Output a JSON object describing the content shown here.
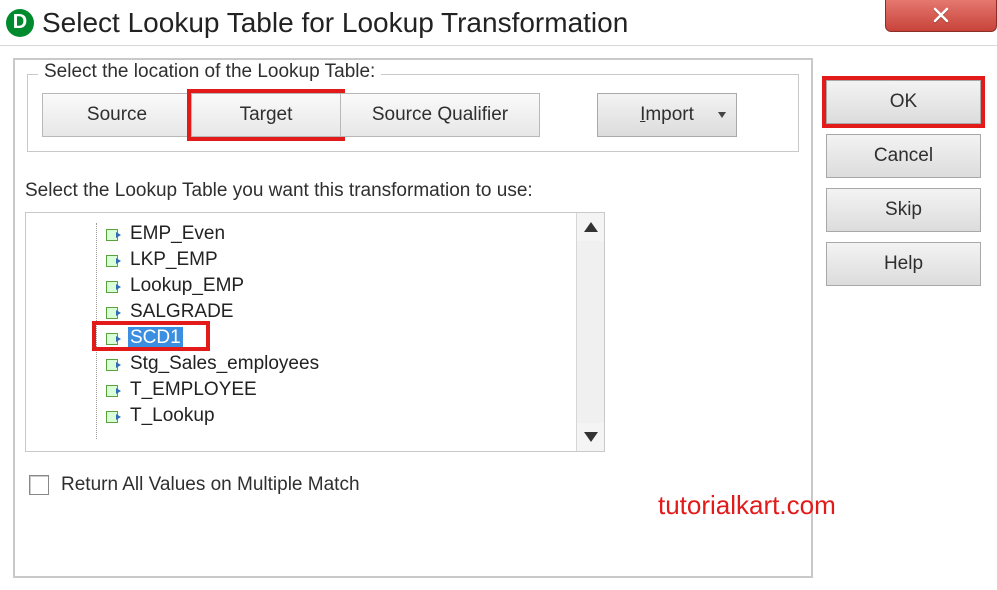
{
  "titlebar": {
    "title": "Select Lookup Table for Lookup Transformation"
  },
  "groupbox": {
    "legend": "Select the location of the Lookup Table:",
    "buttons": {
      "source": "Source",
      "target": "Target",
      "source_qualifier": "Source Qualifier"
    },
    "import_prefix": "I",
    "import_suffix": "mport"
  },
  "list": {
    "label": "Select the Lookup Table you want this transformation to use:",
    "items": [
      {
        "label": "EMP_Even",
        "selected": false
      },
      {
        "label": "LKP_EMP",
        "selected": false
      },
      {
        "label": "Lookup_EMP",
        "selected": false
      },
      {
        "label": "SALGRADE",
        "selected": false
      },
      {
        "label": "SCD1",
        "selected": true
      },
      {
        "label": "Stg_Sales_employees",
        "selected": false
      },
      {
        "label": "T_EMPLOYEE",
        "selected": false
      },
      {
        "label": "T_Lookup",
        "selected": false
      }
    ]
  },
  "checkbox": {
    "label": "Return All Values on Multiple Match",
    "checked": false
  },
  "right": {
    "ok": "OK",
    "cancel": "Cancel",
    "skip": "Skip",
    "help": "Help"
  },
  "watermark": "tutorialkart.com",
  "highlights": {
    "target_button": true,
    "scd1_item": true,
    "ok_button": true
  }
}
